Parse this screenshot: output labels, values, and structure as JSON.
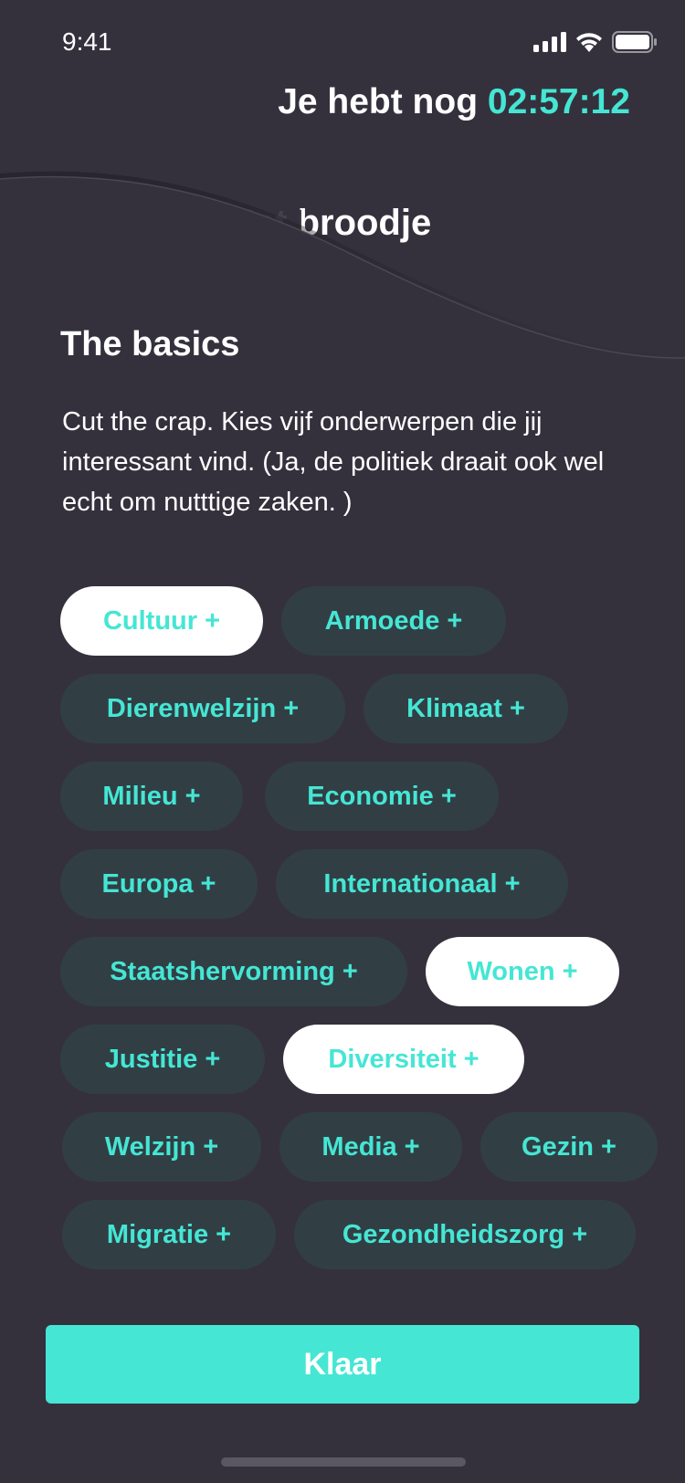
{
  "status_bar": {
    "time": "9:41"
  },
  "header": {
    "timer_prefix": "Je hebt nog",
    "timer_value": "02:57:12",
    "behind_card_title": "Het broodje"
  },
  "content": {
    "title": "The basics",
    "intro": "Cut the crap. Kies vijf onderwerpen die jij interessant vind. (Ja, de politiek draait ook wel echt om nutttige zaken. )"
  },
  "topics": [
    {
      "label": "Cultuur +",
      "selected": true
    },
    {
      "label": "Armoede +",
      "selected": false
    },
    {
      "label": "Dierenwelzijn +",
      "selected": false
    },
    {
      "label": "Klimaat +",
      "selected": false
    },
    {
      "label": "Milieu +",
      "selected": false
    },
    {
      "label": "Economie +",
      "selected": false
    },
    {
      "label": "Europa +",
      "selected": false
    },
    {
      "label": "Internationaal +",
      "selected": false
    },
    {
      "label": "Staatshervorming +",
      "selected": false
    },
    {
      "label": "Wonen +",
      "selected": true
    },
    {
      "label": "Justitie +",
      "selected": false
    },
    {
      "label": "Diversiteit +",
      "selected": true
    },
    {
      "label": "Welzijn +",
      "selected": false
    },
    {
      "label": "Media +",
      "selected": false
    },
    {
      "label": "Gezin +",
      "selected": false
    },
    {
      "label": "Migratie +",
      "selected": false
    },
    {
      "label": "Gezondheidszorg +",
      "selected": false
    }
  ],
  "footer": {
    "done_label": "Klaar"
  },
  "colors": {
    "background": "#34313d",
    "accent": "#45e6d4",
    "chip": "#313f45",
    "chip_selected": "#ffffff"
  }
}
